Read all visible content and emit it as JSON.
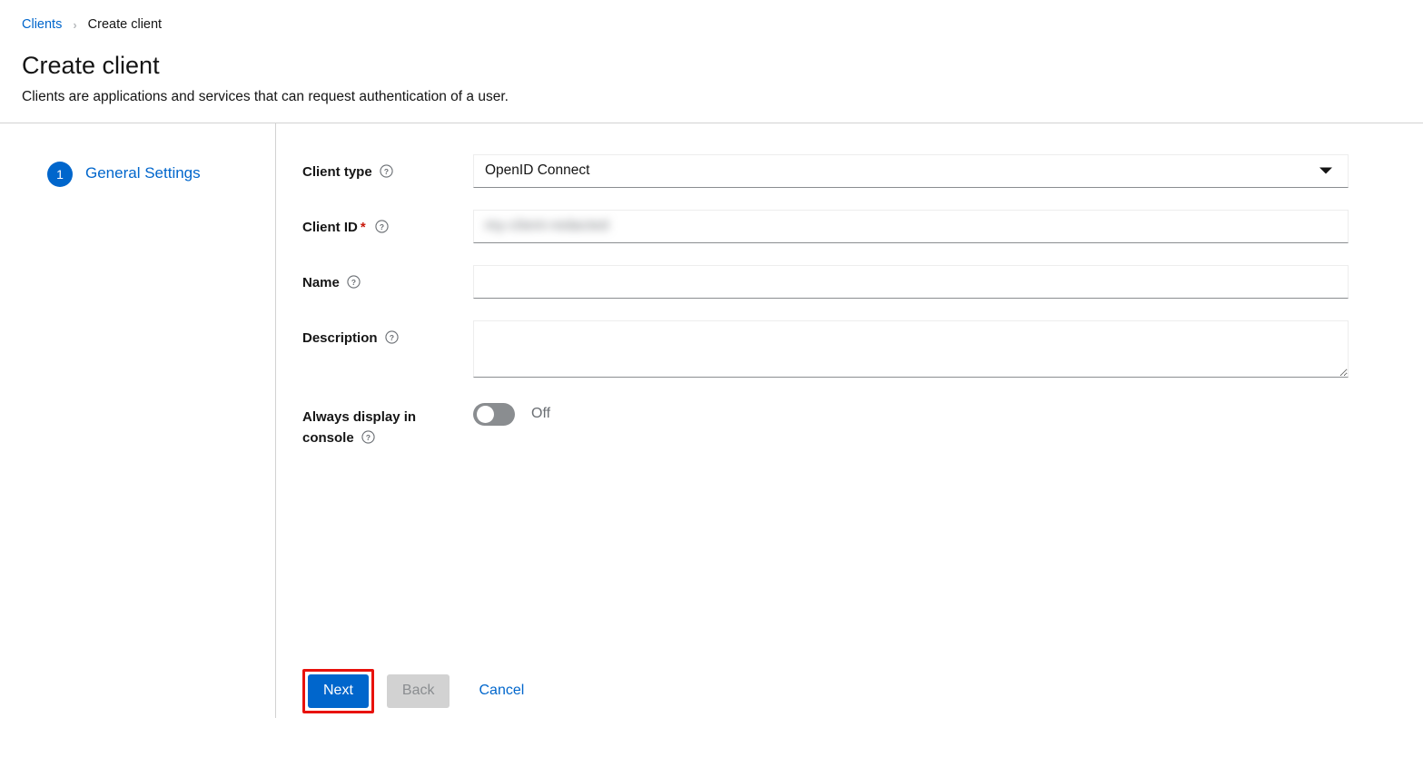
{
  "breadcrumb": {
    "parent": "Clients",
    "separator": "›",
    "current": "Create client"
  },
  "header": {
    "title": "Create client",
    "subtitle": "Clients are applications and services that can request authentication of a user."
  },
  "wizard_nav": {
    "steps": [
      {
        "number": "1",
        "label": "General Settings"
      }
    ]
  },
  "form": {
    "client_type": {
      "label": "Client type",
      "help_icon": "help-circle-icon",
      "value": "OpenID Connect",
      "caret_icon": "caret-down-icon"
    },
    "client_id": {
      "label": "Client ID",
      "required_marker": "*",
      "help_icon": "help-circle-icon",
      "value": "my-client-redacted",
      "redacted": true
    },
    "name": {
      "label": "Name",
      "help_icon": "help-circle-icon",
      "value": "",
      "placeholder": ""
    },
    "description": {
      "label": "Description",
      "help_icon": "help-circle-icon",
      "value": "",
      "placeholder": "",
      "resize_handle_icon": "resize-grip-icon"
    },
    "always_display": {
      "label_line1": "Always display in",
      "label_line2": "console",
      "help_icon": "help-circle-icon",
      "state_label": "Off",
      "checked": false
    }
  },
  "footer": {
    "next_label": "Next",
    "back_label": "Back",
    "cancel_label": "Cancel"
  },
  "colors": {
    "primary": "#0066cc",
    "highlight": "#e8120c",
    "disabled_bg": "#d2d2d2",
    "disabled_text": "#8a8d90",
    "required": "#c9190b",
    "border": "#d2d2d2",
    "input_underline": "#8a8d90"
  }
}
